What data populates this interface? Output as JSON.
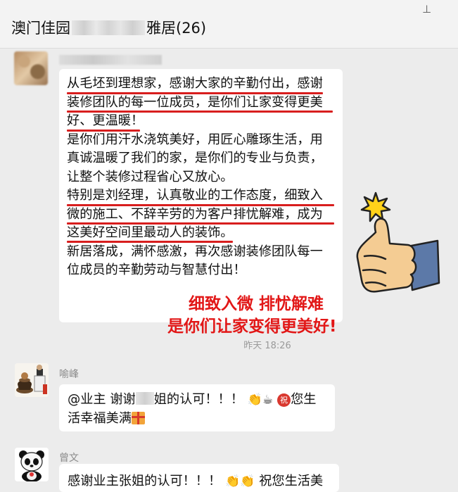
{
  "header": {
    "title_prefix": "澳门佳园",
    "title_suffix": "雅居(26)"
  },
  "messages": [
    {
      "lines": [
        "从毛坯到理想家，感谢大家的辛勤付出，感谢",
        "装修团队的每一位成员，是你们让家变得更美",
        "好、更温暖！",
        "是你们用汗水浇筑美好，用匠心雕琢生活，用",
        "真诚温暖了我们的家，是你们的专业与负责，",
        "让整个装修过程省心又放心。",
        "特别是刘经理，认真敬业的工作态度，细致入",
        "微的施工、不辞辛劳的为客户排忧解难，成为",
        "这美好空间里最动人的装饰。",
        "新居落成，满怀感激，再次感谢装修团队每一",
        "位成员的辛勤劳动与智慧付出！"
      ],
      "slogan_line1": "细致入微 排忧解难",
      "slogan_line2": "是你们让家变得更美好!",
      "time": "昨天 18:26"
    },
    {
      "sender": "喻峰",
      "text_part1": "@业主 谢谢",
      "text_part2": "姐的认可！！！",
      "badge": "祝",
      "text_part3": "您生",
      "text_line2": "活幸福美满"
    },
    {
      "sender": "曾文",
      "text": "感谢业主张姐的认可！！！",
      "text_tail": "祝您生活美"
    }
  ],
  "colors": {
    "highlight": "#d81e1e",
    "slogan": "#e21717",
    "bubble": "#ffffff"
  },
  "icons": [
    "pin-icon",
    "thumbs-up-icon",
    "clapping-hands-icon",
    "coffee-icon",
    "gift-icon"
  ]
}
